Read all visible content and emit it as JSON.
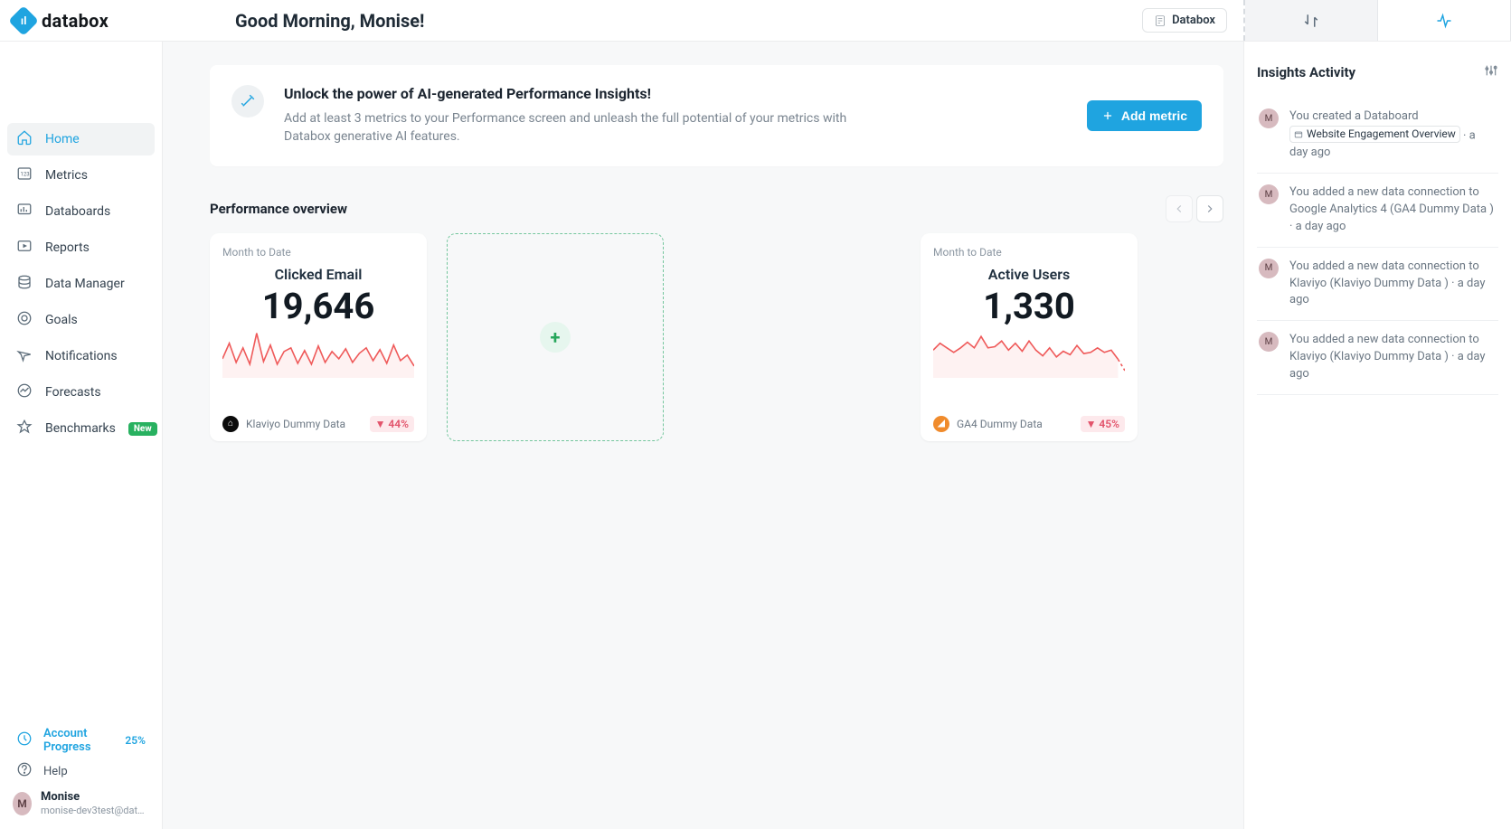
{
  "brand": {
    "name": "databox",
    "mark_glyph": "ıl"
  },
  "header": {
    "greeting": "Good Morning, Monise!",
    "company": "Databox"
  },
  "sidebar": {
    "items": [
      {
        "key": "home",
        "label": "Home",
        "active": true
      },
      {
        "key": "metrics",
        "label": "Metrics",
        "active": false
      },
      {
        "key": "databoards",
        "label": "Databoards",
        "active": false
      },
      {
        "key": "reports",
        "label": "Reports",
        "active": false
      },
      {
        "key": "data-manager",
        "label": "Data Manager",
        "active": false
      },
      {
        "key": "goals",
        "label": "Goals",
        "active": false
      },
      {
        "key": "notifications",
        "label": "Notifications",
        "active": false
      },
      {
        "key": "forecasts",
        "label": "Forecasts",
        "active": false
      },
      {
        "key": "benchmarks",
        "label": "Benchmarks",
        "active": false,
        "badge": "New"
      }
    ],
    "account_progress": {
      "label": "Account Progress",
      "pct": "25%"
    },
    "help_label": "Help",
    "user": {
      "name": "Monise",
      "email": "monise-dev3test@datab..."
    }
  },
  "banner": {
    "title": "Unlock the power of AI-generated Performance Insights!",
    "body": "Add at least 3 metrics to your Performance screen and unleash the full potential of your metrics with Databox generative AI features.",
    "cta": "Add metric"
  },
  "perf": {
    "heading": "Performance overview",
    "cards": {
      "clicked_email": {
        "period": "Month to Date",
        "name": "Clicked Email",
        "value": "19,646",
        "source": "Klaviyo Dummy Data",
        "delta": "44%"
      },
      "active_users": {
        "period": "Month to Date",
        "name": "Active Users",
        "value": "1,330",
        "source": "GA4 Dummy Data",
        "delta": "45%"
      }
    }
  },
  "insights": {
    "title": "Insights Activity",
    "items": [
      {
        "prefix": "You created a Databoard ",
        "tag": "Website Engagement Overview",
        "time": "a day ago"
      },
      {
        "text": "You added a new data connection to Google Analytics 4 (GA4 Dummy Data )",
        "time": "a day ago"
      },
      {
        "text": "You added a new data connection to Klaviyo (Klaviyo Dummy Data )",
        "time": "a day ago"
      },
      {
        "text": "You added a new data connection to Klaviyo (Klaviyo Dummy Data )",
        "time": "a day ago"
      }
    ]
  },
  "chart_data": [
    {
      "type": "line",
      "title": "Clicked Email",
      "x": [
        0,
        1,
        2,
        3,
        4,
        5,
        6,
        7,
        8,
        9,
        10,
        11,
        12,
        13,
        14,
        15,
        16,
        17,
        18,
        19,
        20,
        21,
        22,
        23,
        24,
        25,
        26,
        27,
        28
      ],
      "values": [
        18,
        35,
        14,
        30,
        12,
        46,
        15,
        33,
        12,
        26,
        30,
        13,
        27,
        12,
        32,
        14,
        26,
        18,
        29,
        14,
        24,
        30,
        16,
        28,
        13,
        33,
        16,
        22,
        10
      ],
      "ylim": [
        0,
        50
      ],
      "color": "#ef5a5a"
    },
    {
      "type": "line",
      "title": "Active Users",
      "x": [
        0,
        1,
        2,
        3,
        4,
        5,
        6,
        7,
        8,
        9,
        10,
        11,
        12,
        13,
        14,
        15,
        16,
        17,
        18,
        19,
        20,
        21,
        22,
        23,
        24,
        25,
        26,
        27,
        28
      ],
      "values": [
        22,
        28,
        24,
        20,
        24,
        29,
        24,
        34,
        24,
        25,
        30,
        22,
        28,
        21,
        30,
        22,
        17,
        24,
        16,
        21,
        18,
        26,
        19,
        20,
        24,
        20,
        22,
        14,
        4
      ],
      "ylim": [
        0,
        40
      ],
      "color": "#ef5a5a",
      "trailing_dashed": true
    }
  ]
}
